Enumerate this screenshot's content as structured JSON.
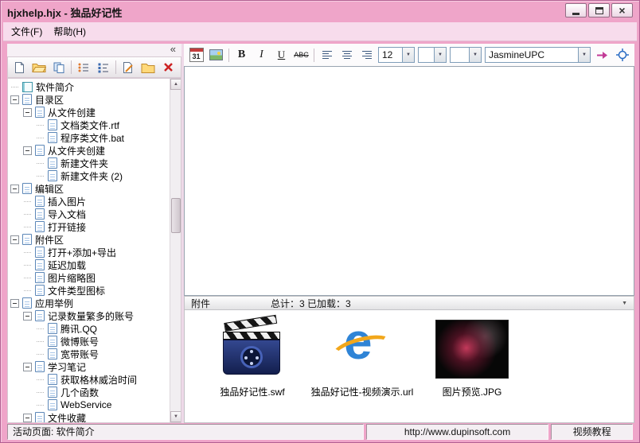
{
  "window": {
    "title": "hjxhelp.hjx - 独品好记性",
    "close_glyph": "×"
  },
  "glyphs": {
    "dropdown": "▼",
    "scroll_up": "▲",
    "scroll_down": "▼",
    "collapse": "«"
  },
  "menu": {
    "items": [
      {
        "label": "文件(F)"
      },
      {
        "label": "帮助(H)"
      }
    ]
  },
  "left_panel": {
    "toolbar_icons": [
      "new-page-icon",
      "open-folder-icon",
      "import-pages-icon",
      "bullet-list-icon",
      "tree-list-icon",
      "edit-page-icon",
      "folder-icon",
      "delete-x-icon"
    ],
    "tree": [
      {
        "label": "软件简介",
        "level": 0,
        "expandable": false,
        "icon": "book"
      },
      {
        "label": "目录区",
        "level": 0,
        "expandable": true,
        "icon": "page"
      },
      {
        "label": "从文件创建",
        "level": 1,
        "expandable": true,
        "icon": "page"
      },
      {
        "label": "文档类文件.rtf",
        "level": 2,
        "expandable": false,
        "icon": "page"
      },
      {
        "label": "程序类文件.bat",
        "level": 2,
        "expandable": false,
        "icon": "page"
      },
      {
        "label": "从文件夹创建",
        "level": 1,
        "expandable": true,
        "icon": "page"
      },
      {
        "label": "新建文件夹",
        "level": 2,
        "expandable": false,
        "icon": "page"
      },
      {
        "label": "新建文件夹 (2)",
        "level": 2,
        "expandable": false,
        "icon": "page"
      },
      {
        "label": "编辑区",
        "level": 0,
        "expandable": true,
        "icon": "page"
      },
      {
        "label": "插入图片",
        "level": 1,
        "expandable": false,
        "icon": "page"
      },
      {
        "label": "导入文档",
        "level": 1,
        "expandable": false,
        "icon": "page"
      },
      {
        "label": "打开链接",
        "level": 1,
        "expandable": false,
        "icon": "page"
      },
      {
        "label": "附件区",
        "level": 0,
        "expandable": true,
        "icon": "page"
      },
      {
        "label": "打开+添加+导出",
        "level": 1,
        "expandable": false,
        "icon": "page"
      },
      {
        "label": "延迟加载",
        "level": 1,
        "expandable": false,
        "icon": "page"
      },
      {
        "label": "图片缩略图",
        "level": 1,
        "expandable": false,
        "icon": "page"
      },
      {
        "label": "文件类型图标",
        "level": 1,
        "expandable": false,
        "icon": "page"
      },
      {
        "label": "应用举例",
        "level": 0,
        "expandable": true,
        "icon": "page"
      },
      {
        "label": "记录数量繁多的账号",
        "level": 1,
        "expandable": true,
        "icon": "page"
      },
      {
        "label": "腾讯.QQ",
        "level": 2,
        "expandable": false,
        "icon": "page"
      },
      {
        "label": "微博账号",
        "level": 2,
        "expandable": false,
        "icon": "page"
      },
      {
        "label": "宽带账号",
        "level": 2,
        "expandable": false,
        "icon": "page"
      },
      {
        "label": "学习笔记",
        "level": 1,
        "expandable": true,
        "icon": "page"
      },
      {
        "label": "获取格林威治时间",
        "level": 2,
        "expandable": false,
        "icon": "page"
      },
      {
        "label": "几个函数",
        "level": 2,
        "expandable": false,
        "icon": "page"
      },
      {
        "label": "WebService",
        "level": 2,
        "expandable": false,
        "icon": "page"
      },
      {
        "label": "文件收藏",
        "level": 1,
        "expandable": true,
        "icon": "page"
      }
    ]
  },
  "editor": {
    "toolbar": {
      "calendar_label": "31",
      "bold": "B",
      "italic": "I",
      "underline": "U",
      "strikethrough": "ABC",
      "font_size": "12",
      "font_name": "JasmineUPC",
      "font_color": "#000000"
    }
  },
  "attachments": {
    "title": "附件",
    "summary": "总计：3 已加载：3",
    "items": [
      {
        "name": "独品好记性.swf",
        "icon": "movie-icon"
      },
      {
        "name": "独品好记性-视频演示.url",
        "icon": "ie-icon",
        "glyph": "e"
      },
      {
        "name": "图片预览.JPG",
        "icon": "photo-icon"
      }
    ]
  },
  "status_bar": {
    "active_page": "活动页面: 软件简介",
    "url": "http://www.dupinsoft.com",
    "link": "视频教程"
  }
}
